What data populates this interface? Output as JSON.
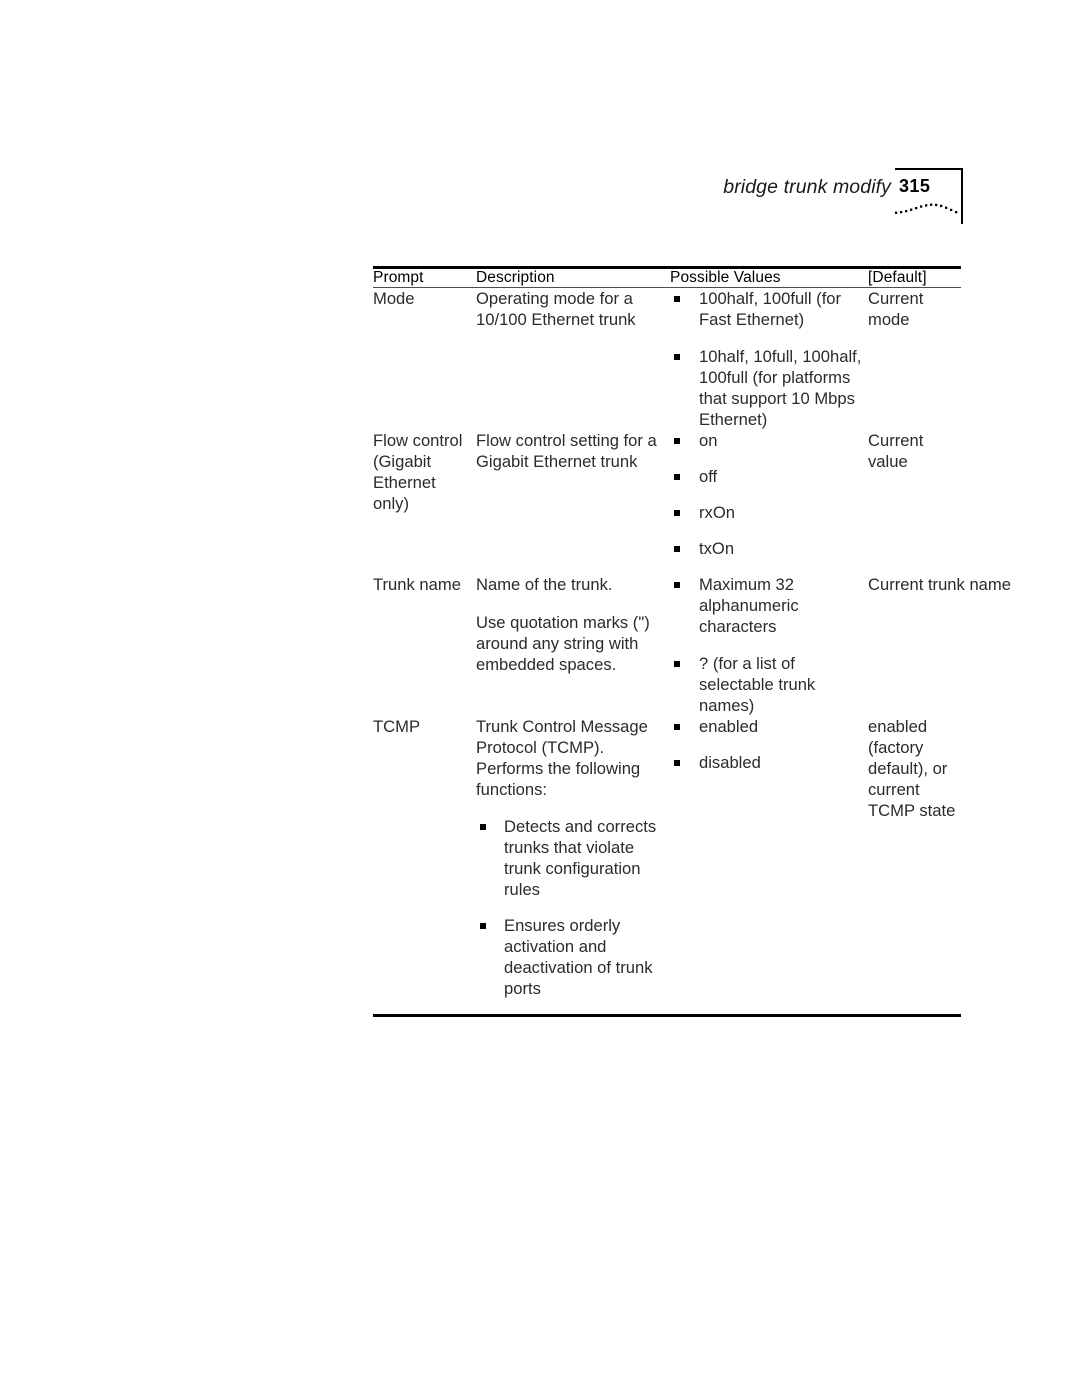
{
  "page": {
    "running_head": "bridge trunk modify",
    "folio": "315",
    "decoration": "dotted-wave"
  },
  "table": {
    "headers": {
      "prompt": "Prompt",
      "description": "Description",
      "possible_values": "Possible Values",
      "default": "[Default]"
    },
    "rows": [
      {
        "prompt": "Mode",
        "description_paragraphs": [
          "Operating mode for a 10/100 Ethernet trunk"
        ],
        "description_bullets": [],
        "possible_values": [
          "100half, 100full (for Fast Ethernet)",
          "10half, 10full, 100half, 100full (for platforms that support 10 Mbps Ethernet)"
        ],
        "default": "Current mode"
      },
      {
        "prompt": "Flow control (Gigabit Ethernet only)",
        "description_paragraphs": [
          "Flow control setting for a Gigabit Ethernet trunk"
        ],
        "description_bullets": [],
        "possible_values": [
          "on",
          "off",
          "rxOn",
          "txOn"
        ],
        "default": "Current value"
      },
      {
        "prompt": "Trunk name",
        "description_paragraphs": [
          "Name of the trunk.",
          "Use quotation marks (\") around any string with embedded spaces."
        ],
        "description_bullets": [],
        "possible_values": [
          "Maximum 32 alphanumeric characters",
          "? (for a list of selectable trunk names)"
        ],
        "default": "Current trunk name"
      },
      {
        "prompt": "TCMP",
        "description_paragraphs": [
          "Trunk Control Message Protocol (TCMP). Performs the following functions:"
        ],
        "description_bullets": [
          "Detects and corrects trunks that violate trunk configuration rules",
          "Ensures orderly activation and deactivation of trunk ports"
        ],
        "possible_values": [
          "enabled",
          "disabled"
        ],
        "default": "enabled (factory default), or current TCMP state"
      }
    ]
  }
}
